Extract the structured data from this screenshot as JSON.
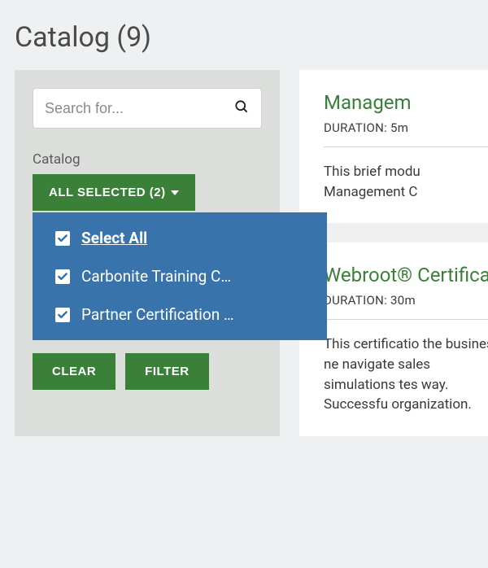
{
  "page": {
    "title": "Catalog (9)"
  },
  "filter": {
    "search_placeholder": "Search for...",
    "label": "Catalog",
    "dropdown_label": "ALL SELECTED (2)",
    "options": {
      "select_all": "Select All",
      "opt1": "Carbonite Training C…",
      "opt2": "Partner Certification …"
    },
    "actions": {
      "clear": "CLEAR",
      "filter": "FILTER"
    }
  },
  "results": [
    {
      "title": "Managem",
      "duration": "DURATION: 5m",
      "desc": "This brief modu Management C"
    },
    {
      "title": "Webroot® Certificati",
      "duration": "DURATION: 30m",
      "desc": "This certificatio the business ne navigate sales simulations tes way. Successfu organization."
    }
  ]
}
